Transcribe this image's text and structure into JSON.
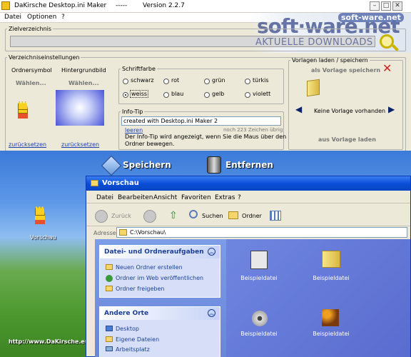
{
  "window": {
    "app_title": "DaKirsche Desktop.ini Maker",
    "title_sep": "-----",
    "version": "Version 2.2.7"
  },
  "menu": [
    "Datei",
    "Optionen",
    "?"
  ],
  "watermark": {
    "brand": "soft·ware.net",
    "badge": "soft-ware.net",
    "subtitle": "AKTUELLE DOWNLOADS"
  },
  "zielverzeichnis": {
    "legend": "Zielverzeichnis",
    "value": ""
  },
  "verzeichnis": {
    "legend": "Verzeichniseinstellungen",
    "ordnersymbol": {
      "label": "Ordnersymbol",
      "select": "Wählen...",
      "reset": "zurücksetzen"
    },
    "hintergrund": {
      "label": "Hintergrundbild",
      "select": "Wählen...",
      "reset": "zurücksetzen"
    }
  },
  "schriftfarbe": {
    "legend": "Schriftfarbe",
    "options": [
      "schwarz",
      "rot",
      "grün",
      "türkis",
      "weiss",
      "blau",
      "gelb",
      "violett"
    ],
    "selected": "weiss"
  },
  "infotip": {
    "legend": "Info-Tip",
    "value": "created with Desktop.ini Maker 2",
    "clear": "leeren",
    "remaining": "noch 223 Zeichen übrig",
    "hint_line1": "Der Info-Tip wird angezeigt, wenn Sie die Maus über den",
    "hint_line2": "Ordner bewegen."
  },
  "vorlagen": {
    "legend": "Vorlagen laden / speichern",
    "save": "als Vorlage speichern",
    "current": "Keine Vorlage vorhanden",
    "load": "aus Vorlage laden"
  },
  "actions": {
    "save": "Speichern",
    "remove": "Entfernen"
  },
  "desktop": {
    "icon_label": "Vorschau",
    "url": "http://www.DaKirsche.eu"
  },
  "preview": {
    "title": "Vorschau",
    "menu": [
      "Datei",
      "Bearbeiten",
      "Ansicht",
      "Favoriten",
      "Extras",
      "?"
    ],
    "toolbar": {
      "back": "Zurück",
      "search": "Suchen",
      "folders": "Ordner"
    },
    "address": {
      "label": "Adresse",
      "value": "C:\\Vorschau\\"
    },
    "tasks": {
      "title": "Datei- und Ordneraufgaben",
      "items": [
        "Neuen Ordner erstellen",
        "Ordner im Web veröffentlichen",
        "Ordner freigeben"
      ]
    },
    "places": {
      "title": "Andere Orte",
      "items": [
        "Desktop",
        "Eigene Dateien",
        "Arbeitsplatz"
      ]
    },
    "files": [
      "Beispieldatei",
      "Beispieldatei",
      "Beispieldatei",
      "Beispieldatei"
    ]
  }
}
